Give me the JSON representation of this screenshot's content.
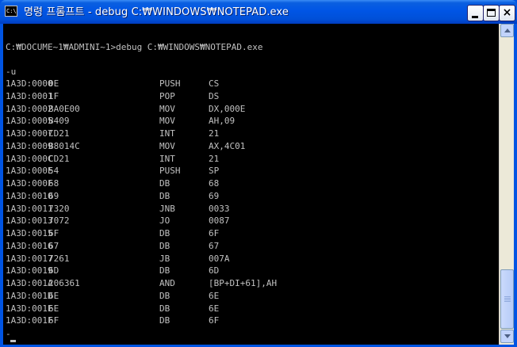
{
  "window": {
    "title": "명령 프롬프트 - debug C:₩WINDOWS₩NOTEPAD.exe",
    "icon_label": "C:\\",
    "icon": "console-icon",
    "buttons": {
      "minimize": "minimize-icon",
      "maximize": "maximize-icon",
      "close": "×"
    }
  },
  "console": {
    "prompt_line": "C:₩DOCUME~1₩ADMINI~1>debug C:₩WINDOWS₩NOTEPAD.exe",
    "command_line": "-u",
    "disassembly": [
      {
        "addr": "1A3D:0000",
        "bytes": "0E",
        "mnemonic": "PUSH",
        "operands": "CS"
      },
      {
        "addr": "1A3D:0001",
        "bytes": "1F",
        "mnemonic": "POP",
        "operands": "DS"
      },
      {
        "addr": "1A3D:0002",
        "bytes": "BA0E00",
        "mnemonic": "MOV",
        "operands": "DX,000E"
      },
      {
        "addr": "1A3D:0005",
        "bytes": "B409",
        "mnemonic": "MOV",
        "operands": "AH,09"
      },
      {
        "addr": "1A3D:0007",
        "bytes": "CD21",
        "mnemonic": "INT",
        "operands": "21"
      },
      {
        "addr": "1A3D:0009",
        "bytes": "B8014C",
        "mnemonic": "MOV",
        "operands": "AX,4C01"
      },
      {
        "addr": "1A3D:000C",
        "bytes": "CD21",
        "mnemonic": "INT",
        "operands": "21"
      },
      {
        "addr": "1A3D:000E",
        "bytes": "54",
        "mnemonic": "PUSH",
        "operands": "SP"
      },
      {
        "addr": "1A3D:000F",
        "bytes": "68",
        "mnemonic": "DB",
        "operands": "68"
      },
      {
        "addr": "1A3D:0010",
        "bytes": "69",
        "mnemonic": "DB",
        "operands": "69"
      },
      {
        "addr": "1A3D:0011",
        "bytes": "7320",
        "mnemonic": "JNB",
        "operands": "0033"
      },
      {
        "addr": "1A3D:0013",
        "bytes": "7072",
        "mnemonic": "JO",
        "operands": "0087"
      },
      {
        "addr": "1A3D:0015",
        "bytes": "6F",
        "mnemonic": "DB",
        "operands": "6F"
      },
      {
        "addr": "1A3D:0016",
        "bytes": "67",
        "mnemonic": "DB",
        "operands": "67"
      },
      {
        "addr": "1A3D:0017",
        "bytes": "7261",
        "mnemonic": "JB",
        "operands": "007A"
      },
      {
        "addr": "1A3D:0019",
        "bytes": "6D",
        "mnemonic": "DB",
        "operands": "6D"
      },
      {
        "addr": "1A3D:001A",
        "bytes": "206361",
        "mnemonic": "AND",
        "operands": "[BP+DI+61],AH"
      },
      {
        "addr": "1A3D:001D",
        "bytes": "6E",
        "mnemonic": "DB",
        "operands": "6E"
      },
      {
        "addr": "1A3D:001E",
        "bytes": "6E",
        "mnemonic": "DB",
        "operands": "6E"
      },
      {
        "addr": "1A3D:001F",
        "bytes": "6F",
        "mnemonic": "DB",
        "operands": "6F"
      }
    ],
    "input_prompt": "-"
  },
  "colors": {
    "titlebar": "#0054e3",
    "console_bg": "#000000",
    "console_text": "#c0c0c0"
  }
}
